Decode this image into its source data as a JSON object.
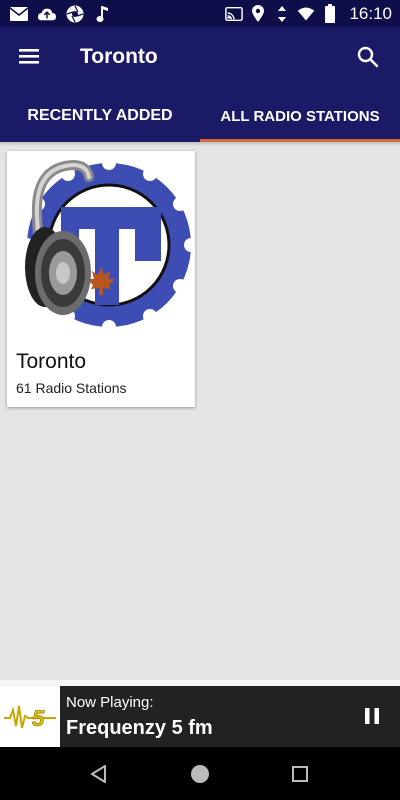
{
  "status_bar": {
    "time": "16:10",
    "icons": [
      "mail-icon",
      "cloud-upload-icon",
      "aperture-icon",
      "music-note-icon",
      "cast-icon",
      "location-icon",
      "data-arrows-icon",
      "wifi-icon",
      "battery-icon"
    ]
  },
  "app_bar": {
    "title": "Toronto",
    "menu_icon": "menu-icon",
    "search_icon": "search-icon"
  },
  "tabs": [
    {
      "label": "RECENTLY ADDED",
      "selected": false
    },
    {
      "label": "ALL RADIO STATIONS",
      "selected": true
    }
  ],
  "cards": [
    {
      "title": "Toronto",
      "subtitle": "61 Radio Stations",
      "image_icon": "headphones-toronto-logo"
    }
  ],
  "now_playing": {
    "label": "Now Playing:",
    "station": "Frequenzy 5 fm",
    "thumb_icon": "frequenzy-logo",
    "control_icon": "pause-icon"
  },
  "nav_bar": {
    "icons": [
      "back-icon",
      "home-icon",
      "recents-icon"
    ]
  },
  "colors": {
    "app_bar": "#1a1a66",
    "status_bar": "#0e0f4a",
    "tab_indicator": "#d86a3a",
    "background": "#e4e4e4",
    "now_playing_bg": "#222222"
  }
}
